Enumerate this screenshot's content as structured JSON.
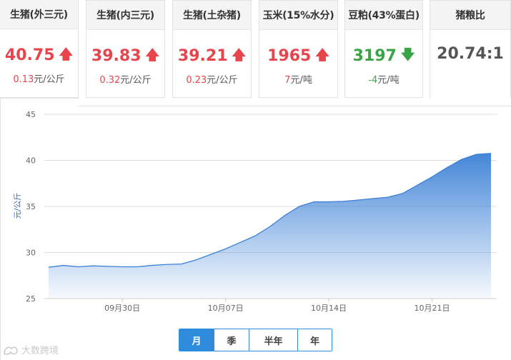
{
  "cards": [
    {
      "label": "生猪(外三元)",
      "value": "40.75",
      "change": "0.13",
      "unit": "元/公斤",
      "direction": "up"
    },
    {
      "label": "生猪(内三元)",
      "value": "39.83",
      "change": "0.32",
      "unit": "元/公斤",
      "direction": "up"
    },
    {
      "label": "生猪(土杂猪)",
      "value": "39.21",
      "change": "0.23",
      "unit": "元/公斤",
      "direction": "up"
    },
    {
      "label": "玉米(15%水分)",
      "value": "1965",
      "change": "7",
      "unit": "元/吨",
      "direction": "up"
    },
    {
      "label": "豆粕(43%蛋白)",
      "value": "3197",
      "change": "-4",
      "unit": "元/吨",
      "direction": "down"
    },
    {
      "label": "猪粮比",
      "value": "20.74:1",
      "change": "",
      "unit": "",
      "direction": "none"
    }
  ],
  "icons": {
    "up": "arrow-up-icon",
    "down": "arrow-down-icon"
  },
  "colors": {
    "up": "#e8444c",
    "down": "#3aa347",
    "series": "#3b80d6",
    "tab_active": "#2f8bdb"
  },
  "tabs": [
    {
      "label": "月",
      "active": true
    },
    {
      "label": "季",
      "active": false
    },
    {
      "label": "半年",
      "active": false
    },
    {
      "label": "年",
      "active": false
    }
  ],
  "watermark": "大数跨境",
  "chart_data": {
    "type": "area",
    "ylabel": "元/公斤",
    "ylim": [
      25,
      45
    ],
    "yticks": [
      25,
      30,
      35,
      40,
      45
    ],
    "xticks": [
      "09月30日",
      "10月07日",
      "10月14日",
      "10月21日"
    ],
    "grid": true,
    "x": [
      "09-25",
      "09-26",
      "09-27",
      "09-28",
      "09-29",
      "09-30",
      "10-01",
      "10-02",
      "10-03",
      "10-04",
      "10-05",
      "10-06",
      "10-07",
      "10-08",
      "10-09",
      "10-10",
      "10-11",
      "10-12",
      "10-13",
      "10-14",
      "10-15",
      "10-16",
      "10-17",
      "10-18",
      "10-19",
      "10-20",
      "10-21",
      "10-22",
      "10-23",
      "10-24",
      "10-25"
    ],
    "series": [
      {
        "values": [
          28.4,
          28.6,
          28.45,
          28.55,
          28.5,
          28.45,
          28.45,
          28.6,
          28.7,
          28.75,
          29.2,
          29.8,
          30.4,
          31.1,
          31.8,
          32.8,
          34.0,
          35.0,
          35.5,
          35.5,
          35.55,
          35.7,
          35.85,
          36.0,
          36.4,
          37.3,
          38.2,
          39.2,
          40.1,
          40.65,
          40.75
        ]
      }
    ]
  }
}
